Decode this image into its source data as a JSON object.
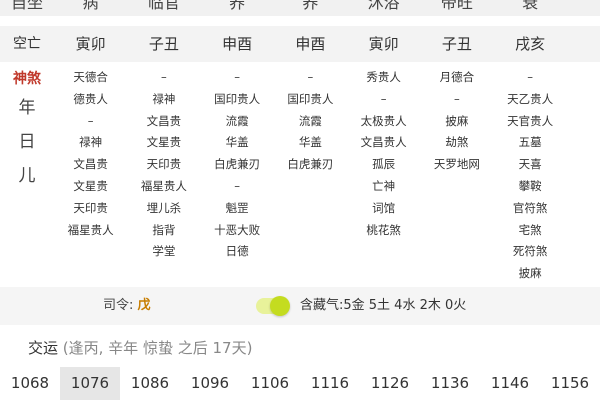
{
  "state_row": [
    "自坐",
    "病",
    "临官",
    "养",
    "养",
    "沐浴",
    "帝旺",
    "衰"
  ],
  "kong_row": {
    "label": "空亡",
    "values": [
      "寅卯",
      "子丑",
      "申酉",
      "申酉",
      "寅卯",
      "子丑",
      "戌亥"
    ]
  },
  "shensha": {
    "label_red": "神煞",
    "label_chars": [
      "年",
      "日",
      "儿"
    ],
    "columns": [
      [
        "天德合",
        "德贵人",
        "–",
        "禄神",
        "文昌贵",
        "文星贵",
        "天印贵",
        "福星贵人"
      ],
      [
        "–",
        "禄神",
        "文昌贵",
        "文星贵",
        "天印贵",
        "福星贵人",
        "埋儿杀",
        "指背",
        "学堂"
      ],
      [
        "–",
        "国印贵人",
        "流霞",
        "华盖",
        "白虎兼刃",
        "–",
        "魁罡",
        "十恶大败",
        "日德"
      ],
      [
        "–",
        "国印贵人",
        "流霞",
        "华盖",
        "白虎兼刃"
      ],
      [
        "秀贵人",
        "–",
        "太极贵人",
        "文昌贵人",
        "孤辰",
        "亡神",
        "词馆",
        "桃花煞"
      ],
      [
        "月德合",
        "–",
        "披麻",
        "劫煞",
        "天罗地网"
      ],
      [
        "–",
        "天乙贵人",
        "天官贵人",
        "五墓",
        "天喜",
        "攀鞍",
        "官符煞",
        "宅煞",
        "死符煞",
        "披麻"
      ]
    ]
  },
  "siling": {
    "label": "司令: ",
    "gan": "戊",
    "canggan": "含藏气:5金 5土 4水 2木 0火",
    "toggle_color": "#c4dc20"
  },
  "jiaoyun": {
    "label": "交运",
    "detail": "(逢丙, 辛年 惊蛰 之后 17天)"
  },
  "years": [
    "1068",
    "1076",
    "1086",
    "1096",
    "1106",
    "1116",
    "1126",
    "1136",
    "1146",
    "1156"
  ],
  "active_year_index": 1,
  "colors": {
    "accent_red": "#c0392b",
    "gan_orange": "#c77d00"
  }
}
